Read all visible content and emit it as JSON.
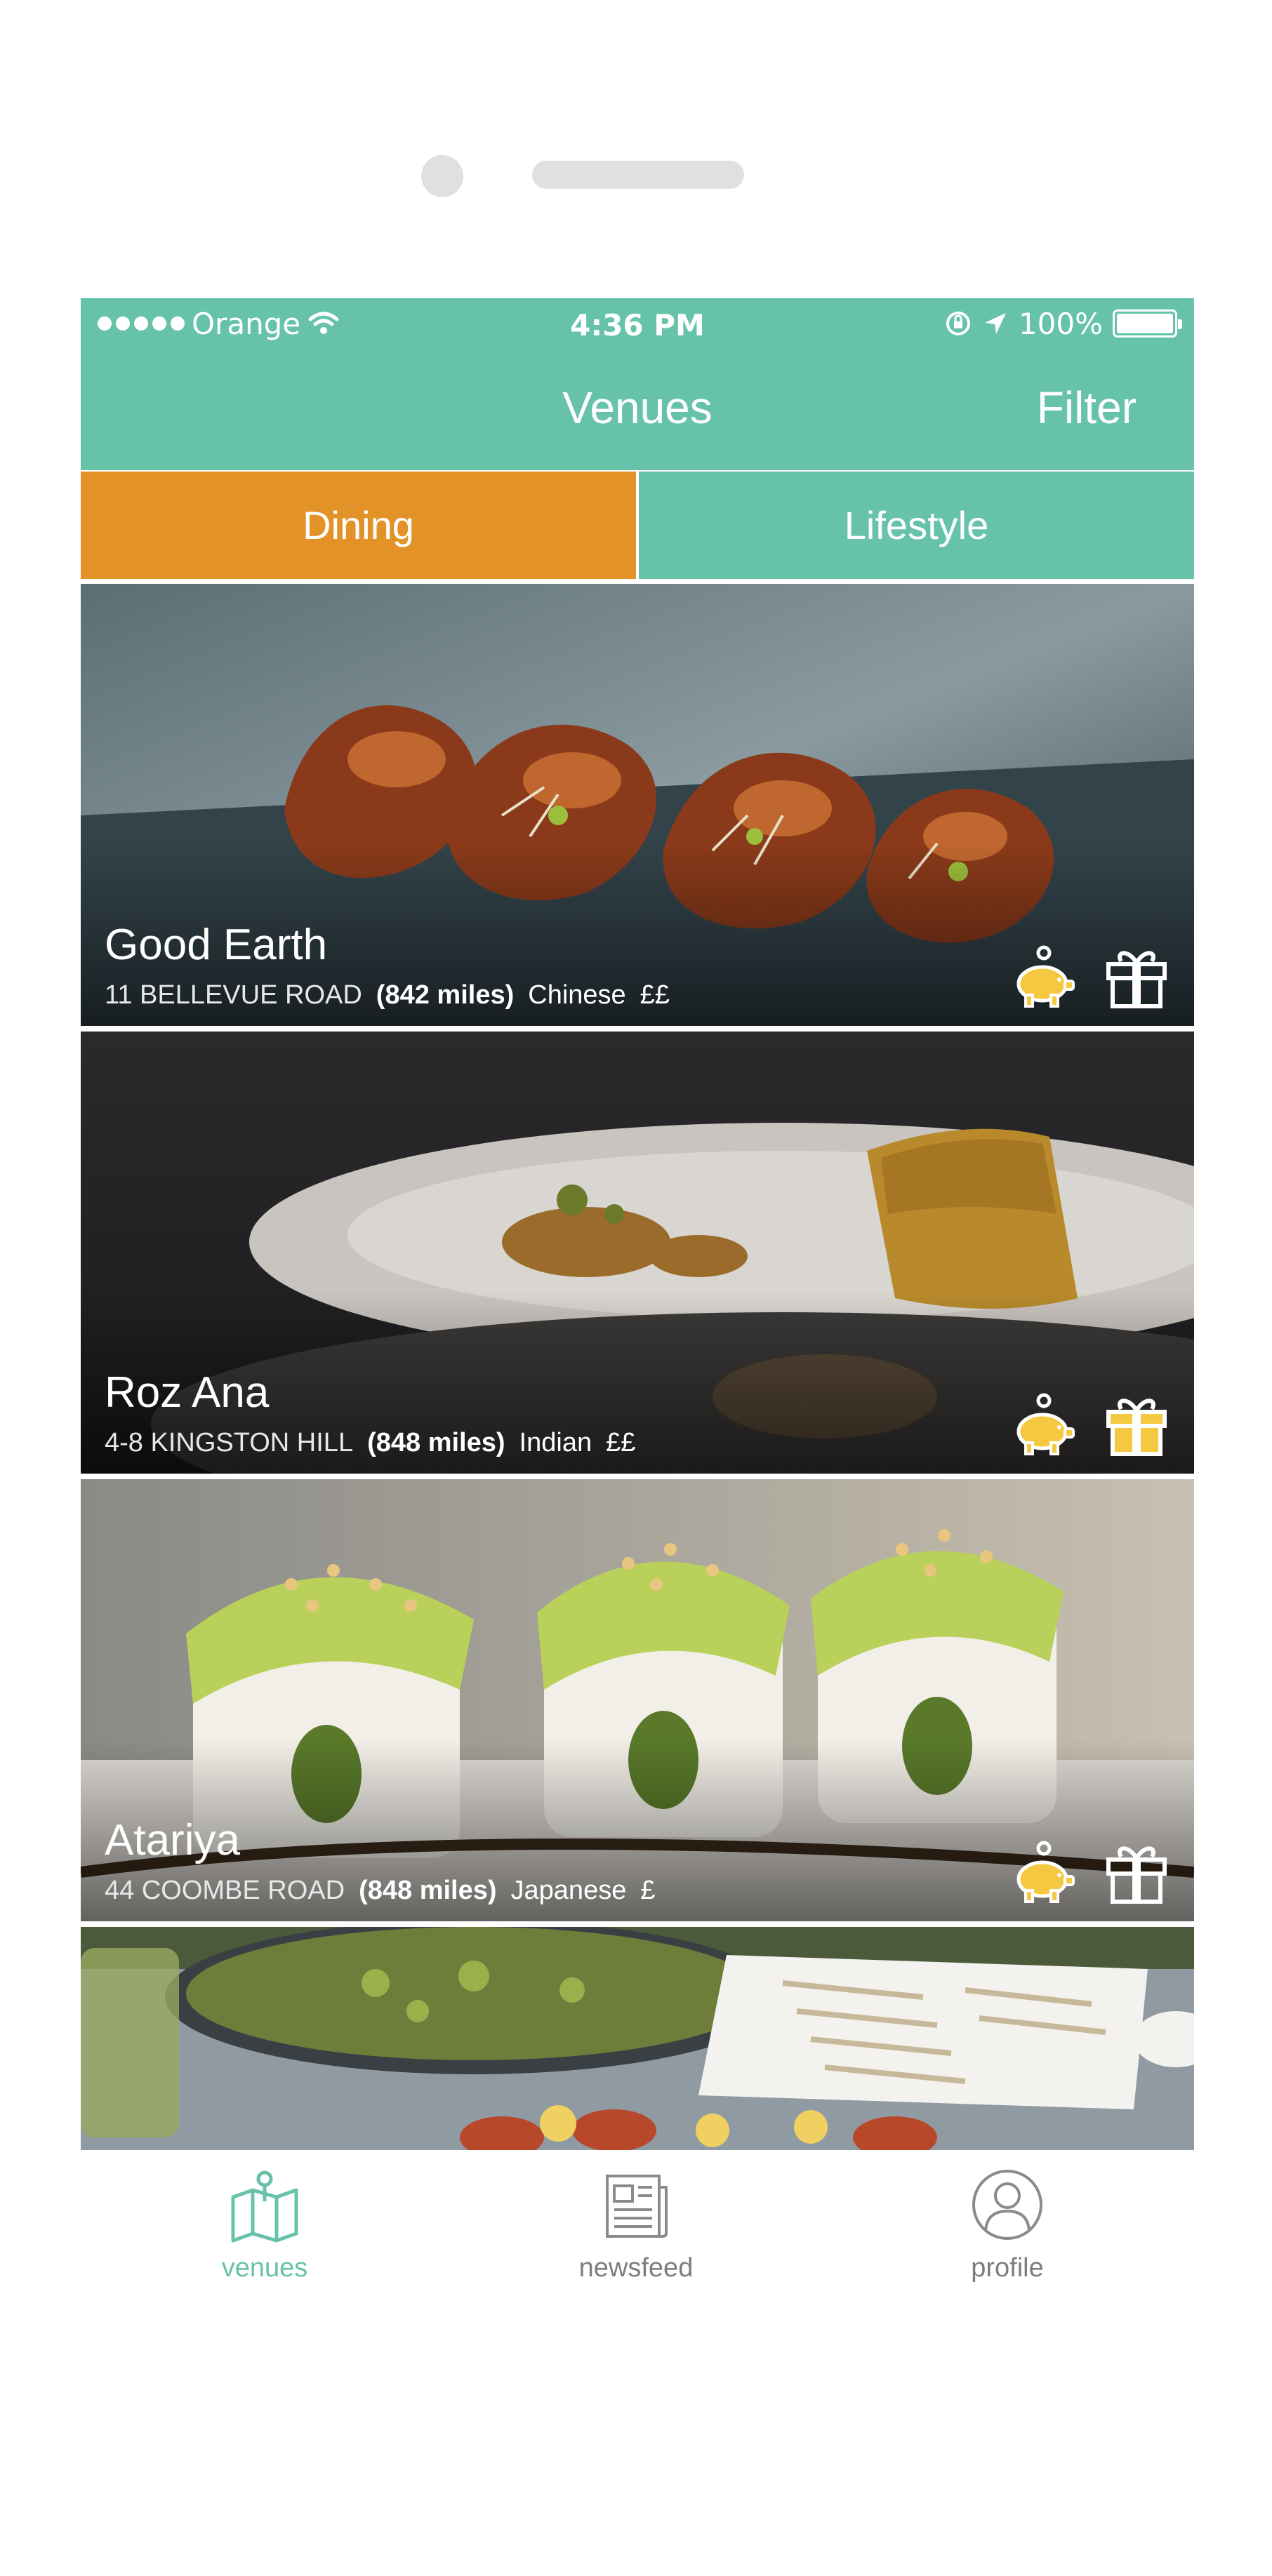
{
  "status_bar": {
    "carrier": "Orange",
    "time": "4:36 PM",
    "battery": "100%"
  },
  "nav": {
    "title": "Venues",
    "filter_label": "Filter"
  },
  "segments": [
    {
      "label": "Dining",
      "active": true
    },
    {
      "label": "Lifestyle",
      "active": false
    }
  ],
  "venues": [
    {
      "name": "Good Earth",
      "address": "11 BELLEVUE ROAD",
      "distance": "(842 miles)",
      "cuisine": "Chinese",
      "price": "££",
      "icons": [
        "piggy-bank-icon",
        "gift-icon"
      ]
    },
    {
      "name": "Roz Ana",
      "address": "4-8 KINGSTON HILL",
      "distance": "(848 miles)",
      "cuisine": "Indian",
      "price": "££",
      "icons": [
        "piggy-bank-icon",
        "gift-icon"
      ]
    },
    {
      "name": "Atariya",
      "address": "44 COOMBE ROAD",
      "distance": "(848 miles)",
      "cuisine": "Japanese",
      "price": "£",
      "icons": [
        "piggy-bank-icon",
        "gift-icon"
      ]
    }
  ],
  "tab_bar": [
    {
      "label": "venues",
      "icon": "map-icon",
      "active": true
    },
    {
      "label": "newsfeed",
      "icon": "newspaper-icon",
      "active": false
    },
    {
      "label": "profile",
      "icon": "profile-icon",
      "active": false
    }
  ],
  "colors": {
    "accent_green": "#66c3aa",
    "accent_orange": "#e39227",
    "icon_yellow": "#f5c842"
  }
}
